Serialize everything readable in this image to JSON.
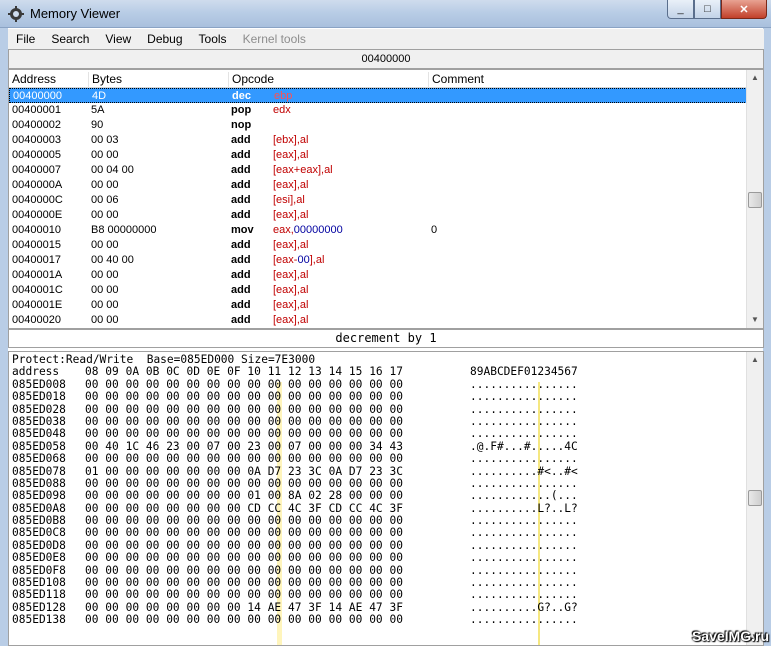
{
  "window": {
    "title": "Memory Viewer",
    "min_label": "_",
    "max_label": "□",
    "close_label": "✕"
  },
  "menu": [
    "File",
    "Search",
    "View",
    "Debug",
    "Tools",
    "Kernel tools"
  ],
  "address_bar": "00400000",
  "disassembler": {
    "headers": [
      "Address",
      "Bytes",
      "Opcode",
      "Comment"
    ],
    "rows": [
      {
        "addr": "00400000",
        "bytes": "4D",
        "op": "dec",
        "arg": "ebp",
        "comment": "",
        "selected": true
      },
      {
        "addr": "00400001",
        "bytes": "5A",
        "op": "pop",
        "arg": "edx",
        "comment": ""
      },
      {
        "addr": "00400002",
        "bytes": "90",
        "op": "nop",
        "arg": "",
        "comment": ""
      },
      {
        "addr": "00400003",
        "bytes": "00 03",
        "op": "add",
        "arg": "[ebx],al",
        "comment": ""
      },
      {
        "addr": "00400005",
        "bytes": "00 00",
        "op": "add",
        "arg": "[eax],al",
        "comment": ""
      },
      {
        "addr": "00400007",
        "bytes": "00 04 00",
        "op": "add",
        "arg": "[eax+eax],al",
        "comment": ""
      },
      {
        "addr": "0040000A",
        "bytes": "00 00",
        "op": "add",
        "arg": "[eax],al",
        "comment": ""
      },
      {
        "addr": "0040000C",
        "bytes": "00 06",
        "op": "add",
        "arg": "[esi],al",
        "comment": ""
      },
      {
        "addr": "0040000E",
        "bytes": "00 00",
        "op": "add",
        "arg": "[eax],al",
        "comment": ""
      },
      {
        "addr": "00400010",
        "bytes": "B8 00000000",
        "op": "mov",
        "arg": "eax,00000000",
        "comment": "0"
      },
      {
        "addr": "00400015",
        "bytes": "00 00",
        "op": "add",
        "arg": "[eax],al",
        "comment": ""
      },
      {
        "addr": "00400017",
        "bytes": "00 40 00",
        "op": "add",
        "arg": "[eax-00],al",
        "comment": ""
      },
      {
        "addr": "0040001A",
        "bytes": "00 00",
        "op": "add",
        "arg": "[eax],al",
        "comment": ""
      },
      {
        "addr": "0040001C",
        "bytes": "00 00",
        "op": "add",
        "arg": "[eax],al",
        "comment": ""
      },
      {
        "addr": "0040001E",
        "bytes": "00 00",
        "op": "add",
        "arg": "[eax],al",
        "comment": ""
      },
      {
        "addr": "00400020",
        "bytes": "00 00",
        "op": "add",
        "arg": "[eax],al",
        "comment": ""
      }
    ]
  },
  "status": "decrement by 1",
  "hex": {
    "protect_line": "Protect:Read/Write  Base=085ED000 Size=7E3000",
    "header": {
      "address": "address",
      "cols": [
        "08",
        "09",
        "0A",
        "0B",
        "0C",
        "0D",
        "0E",
        "0F",
        "10",
        "11",
        "12",
        "13",
        "14",
        "15",
        "16",
        "17"
      ],
      "ascii": "89ABCDEF01234567"
    },
    "rows": [
      {
        "addr": "085ED008",
        "bytes": [
          "00",
          "00",
          "00",
          "00",
          "00",
          "00",
          "00",
          "00",
          "00",
          "00",
          "00",
          "00",
          "00",
          "00",
          "00",
          "00"
        ],
        "ascii": "................"
      },
      {
        "addr": "085ED018",
        "bytes": [
          "00",
          "00",
          "00",
          "00",
          "00",
          "00",
          "00",
          "00",
          "00",
          "00",
          "00",
          "00",
          "00",
          "00",
          "00",
          "00"
        ],
        "ascii": "................"
      },
      {
        "addr": "085ED028",
        "bytes": [
          "00",
          "00",
          "00",
          "00",
          "00",
          "00",
          "00",
          "00",
          "00",
          "00",
          "00",
          "00",
          "00",
          "00",
          "00",
          "00"
        ],
        "ascii": "................"
      },
      {
        "addr": "085ED038",
        "bytes": [
          "00",
          "00",
          "00",
          "00",
          "00",
          "00",
          "00",
          "00",
          "00",
          "00",
          "00",
          "00",
          "00",
          "00",
          "00",
          "00"
        ],
        "ascii": "................"
      },
      {
        "addr": "085ED048",
        "bytes": [
          "00",
          "00",
          "00",
          "00",
          "00",
          "00",
          "00",
          "00",
          "00",
          "00",
          "00",
          "00",
          "00",
          "00",
          "00",
          "00"
        ],
        "ascii": "................"
      },
      {
        "addr": "085ED058",
        "bytes": [
          "00",
          "40",
          "1C",
          "46",
          "23",
          "00",
          "07",
          "00",
          "23",
          "00",
          "07",
          "00",
          "00",
          "00",
          "34",
          "43"
        ],
        "ascii": ".@.F#...#.....4C"
      },
      {
        "addr": "085ED068",
        "bytes": [
          "00",
          "00",
          "00",
          "00",
          "00",
          "00",
          "00",
          "00",
          "00",
          "00",
          "00",
          "00",
          "00",
          "00",
          "00",
          "00"
        ],
        "ascii": "................"
      },
      {
        "addr": "085ED078",
        "bytes": [
          "01",
          "00",
          "00",
          "00",
          "00",
          "00",
          "00",
          "00",
          "0A",
          "D7",
          "23",
          "3C",
          "0A",
          "D7",
          "23",
          "3C"
        ],
        "ascii": "..........#<..#<"
      },
      {
        "addr": "085ED088",
        "bytes": [
          "00",
          "00",
          "00",
          "00",
          "00",
          "00",
          "00",
          "00",
          "00",
          "00",
          "00",
          "00",
          "00",
          "00",
          "00",
          "00"
        ],
        "ascii": "................"
      },
      {
        "addr": "085ED098",
        "bytes": [
          "00",
          "00",
          "00",
          "00",
          "00",
          "00",
          "00",
          "00",
          "01",
          "00",
          "8A",
          "02",
          "28",
          "00",
          "00",
          "00"
        ],
        "ascii": "............(..."
      },
      {
        "addr": "085ED0A8",
        "bytes": [
          "00",
          "00",
          "00",
          "00",
          "00",
          "00",
          "00",
          "00",
          "CD",
          "CC",
          "4C",
          "3F",
          "CD",
          "CC",
          "4C",
          "3F"
        ],
        "ascii": "..........L?..L?"
      },
      {
        "addr": "085ED0B8",
        "bytes": [
          "00",
          "00",
          "00",
          "00",
          "00",
          "00",
          "00",
          "00",
          "00",
          "00",
          "00",
          "00",
          "00",
          "00",
          "00",
          "00"
        ],
        "ascii": "................"
      },
      {
        "addr": "085ED0C8",
        "bytes": [
          "00",
          "00",
          "00",
          "00",
          "00",
          "00",
          "00",
          "00",
          "00",
          "00",
          "00",
          "00",
          "00",
          "00",
          "00",
          "00"
        ],
        "ascii": "................"
      },
      {
        "addr": "085ED0D8",
        "bytes": [
          "00",
          "00",
          "00",
          "00",
          "00",
          "00",
          "00",
          "00",
          "00",
          "00",
          "00",
          "00",
          "00",
          "00",
          "00",
          "00"
        ],
        "ascii": "................"
      },
      {
        "addr": "085ED0E8",
        "bytes": [
          "00",
          "00",
          "00",
          "00",
          "00",
          "00",
          "00",
          "00",
          "00",
          "00",
          "00",
          "00",
          "00",
          "00",
          "00",
          "00"
        ],
        "ascii": "................"
      },
      {
        "addr": "085ED0F8",
        "bytes": [
          "00",
          "00",
          "00",
          "00",
          "00",
          "00",
          "00",
          "00",
          "00",
          "00",
          "00",
          "00",
          "00",
          "00",
          "00",
          "00"
        ],
        "ascii": "................"
      },
      {
        "addr": "085ED108",
        "bytes": [
          "00",
          "00",
          "00",
          "00",
          "00",
          "00",
          "00",
          "00",
          "00",
          "00",
          "00",
          "00",
          "00",
          "00",
          "00",
          "00"
        ],
        "ascii": "................"
      },
      {
        "addr": "085ED118",
        "bytes": [
          "00",
          "00",
          "00",
          "00",
          "00",
          "00",
          "00",
          "00",
          "00",
          "00",
          "00",
          "00",
          "00",
          "00",
          "00",
          "00"
        ],
        "ascii": "................"
      },
      {
        "addr": "085ED128",
        "bytes": [
          "00",
          "00",
          "00",
          "00",
          "00",
          "00",
          "00",
          "00",
          "14",
          "AE",
          "47",
          "3F",
          "14",
          "AE",
          "47",
          "3F"
        ],
        "ascii": "..........G?..G?"
      },
      {
        "addr": "085ED138",
        "bytes": [
          "00",
          "00",
          "00",
          "00",
          "00",
          "00",
          "00",
          "00",
          "00",
          "00",
          "00",
          "00",
          "00",
          "00",
          "00",
          "00"
        ],
        "ascii": "................"
      }
    ]
  },
  "watermark": "SaveIMG.ru",
  "colors": {
    "selection": "#3399ff",
    "register": "#c00000",
    "number": "#0000a0",
    "caret_column": "#f3e36a"
  },
  "icons": {
    "app": "gear-icon",
    "scroll_up": "chevron-up-icon",
    "scroll_down": "chevron-down-icon"
  }
}
